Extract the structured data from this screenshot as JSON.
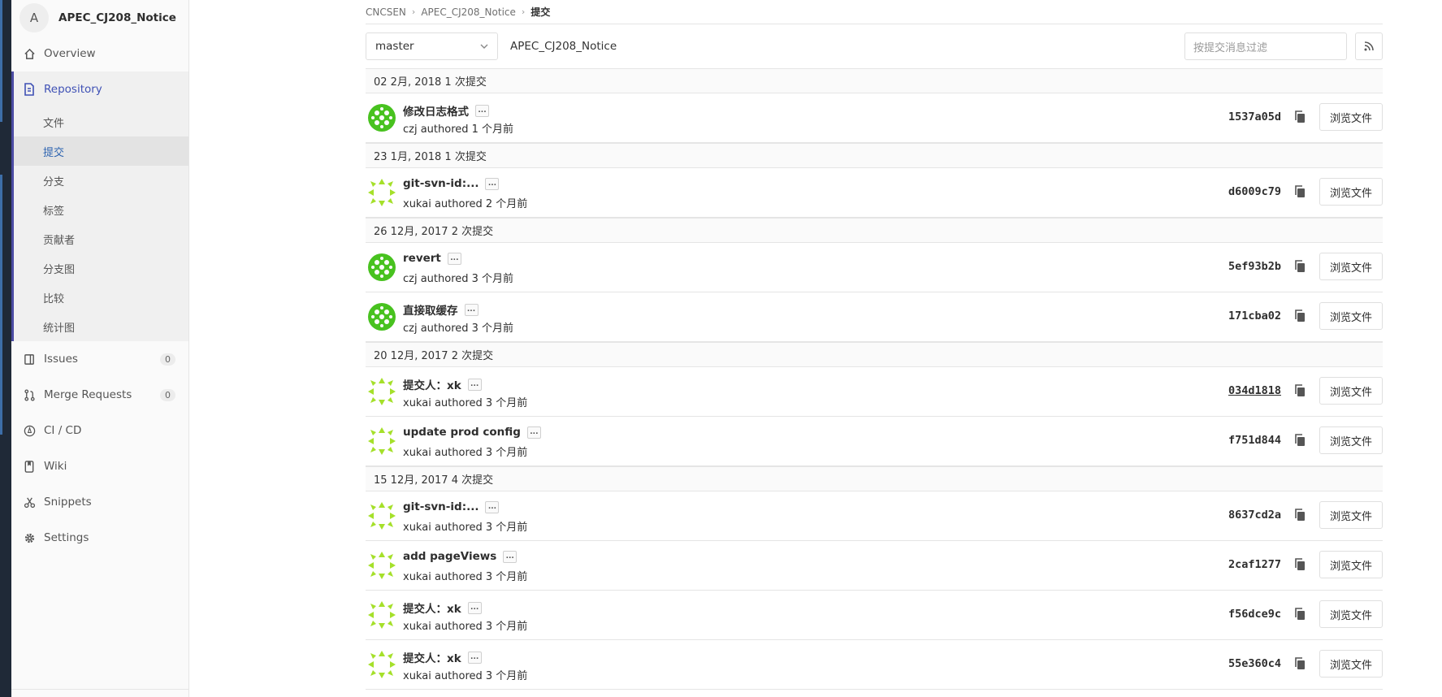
{
  "project": {
    "avatar_letter": "A",
    "name": "APEC_CJ208_Notice"
  },
  "sidebar": {
    "overview": "Overview",
    "repository": "Repository",
    "repository_items": [
      "文件",
      "提交",
      "分支",
      "标签",
      "贡献者",
      "分支图",
      "比较",
      "统计图"
    ],
    "active_subitem": "提交",
    "issues": {
      "label": "Issues",
      "count": "0"
    },
    "merge_requests": {
      "label": "Merge Requests",
      "count": "0"
    },
    "cicd": "CI / CD",
    "wiki": "Wiki",
    "snippets": "Snippets",
    "settings": "Settings"
  },
  "breadcrumb": {
    "group": "CNCSEN",
    "project": "APEC_CJ208_Notice",
    "current": "提交"
  },
  "toolbar": {
    "branch": "master",
    "project_label": "APEC_CJ208_Notice",
    "filter_placeholder": "按提交消息过滤"
  },
  "commit_days": [
    {
      "header": "02 2月, 2018 1 次提交",
      "commits": [
        {
          "title": "修改日志格式",
          "meta": "czj authored 1 个月前",
          "sha": "1537a05d",
          "avatar": "green",
          "browse": "浏览文件",
          "ellipsis": "..."
        }
      ]
    },
    {
      "header": "23 1月, 2018 1 次提交",
      "commits": [
        {
          "title": "git-svn-id:...",
          "meta": "xukai authored 2 个月前",
          "sha": "d6009c79",
          "avatar": "lime",
          "browse": "浏览文件",
          "ellipsis": "..."
        }
      ]
    },
    {
      "header": "26 12月, 2017 2 次提交",
      "commits": [
        {
          "title": "revert",
          "meta": "czj authored 3 个月前",
          "sha": "5ef93b2b",
          "avatar": "green",
          "browse": "浏览文件",
          "ellipsis": "..."
        },
        {
          "title": "直接取缓存",
          "meta": "czj authored 3 个月前",
          "sha": "171cba02",
          "avatar": "green",
          "browse": "浏览文件",
          "ellipsis": "..."
        }
      ]
    },
    {
      "header": "20 12月, 2017 2 次提交",
      "commits": [
        {
          "title": "提交人：xk",
          "meta": "xukai authored 3 个月前",
          "sha": "034d1818",
          "avatar": "lime",
          "browse": "浏览文件",
          "ellipsis": "...",
          "underline": true
        },
        {
          "title": "update prod config",
          "meta": "xukai authored 3 个月前",
          "sha": "f751d844",
          "avatar": "lime",
          "browse": "浏览文件",
          "ellipsis": "..."
        }
      ]
    },
    {
      "header": "15 12月, 2017 4 次提交",
      "commits": [
        {
          "title": "git-svn-id:...",
          "meta": "xukai authored 3 个月前",
          "sha": "8637cd2a",
          "avatar": "lime",
          "browse": "浏览文件",
          "ellipsis": "..."
        },
        {
          "title": "add pageViews",
          "meta": "xukai authored 3 个月前",
          "sha": "2caf1277",
          "avatar": "lime",
          "browse": "浏览文件",
          "ellipsis": "..."
        },
        {
          "title": "提交人：xk",
          "meta": "xukai authored 3 个月前",
          "sha": "f56dce9c",
          "avatar": "lime",
          "browse": "浏览文件",
          "ellipsis": "..."
        },
        {
          "title": "提交人：xk",
          "meta": "xukai authored 3 个月前",
          "sha": "55e360c4",
          "avatar": "lime",
          "browse": "浏览文件",
          "ellipsis": "..."
        }
      ]
    }
  ],
  "colors": {
    "accent": "#3f51b5",
    "avatar_green": "#48c21f",
    "avatar_lime": "#a5e02a"
  }
}
